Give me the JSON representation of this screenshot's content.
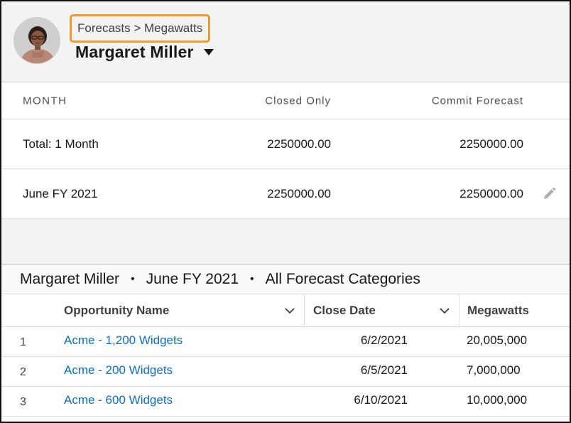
{
  "header": {
    "breadcrumb": "Forecasts > Megawatts",
    "person_name": "Margaret Miller"
  },
  "forecast_table": {
    "columns": {
      "month": "MONTH",
      "closed": "Closed Only",
      "commit": "Commit Forecast"
    },
    "rows": [
      {
        "month": "Total: 1 Month",
        "closed": "2250000.00",
        "commit": "2250000.00"
      },
      {
        "month": "June FY 2021",
        "closed": "2250000.00",
        "commit": "2250000.00"
      }
    ]
  },
  "detail": {
    "title": {
      "owner": "Margaret Miller",
      "sep": "•",
      "period": "June FY 2021",
      "category": "All Forecast Categories"
    },
    "columns": {
      "name": "Opportunity Name",
      "date": "Close Date",
      "megawatts": "Megawatts"
    },
    "rows": [
      {
        "num": "1",
        "name": "Acme - 1,200 Widgets",
        "date": "6/2/2021",
        "megawatts": "20,005,000"
      },
      {
        "num": "2",
        "name": "Acme - 200 Widgets",
        "date": "6/5/2021",
        "megawatts": "7,000,000"
      },
      {
        "num": "3",
        "name": "Acme - 600 Widgets",
        "date": "6/10/2021",
        "megawatts": "10,000,000"
      }
    ]
  },
  "colors": {
    "link": "#0b6fc5",
    "highlight": "#f29b2b",
    "band": "#f3f3f3"
  },
  "icons": [
    "avatar",
    "dropdown-caret-icon",
    "pencil-icon",
    "chevron-down-icon"
  ]
}
